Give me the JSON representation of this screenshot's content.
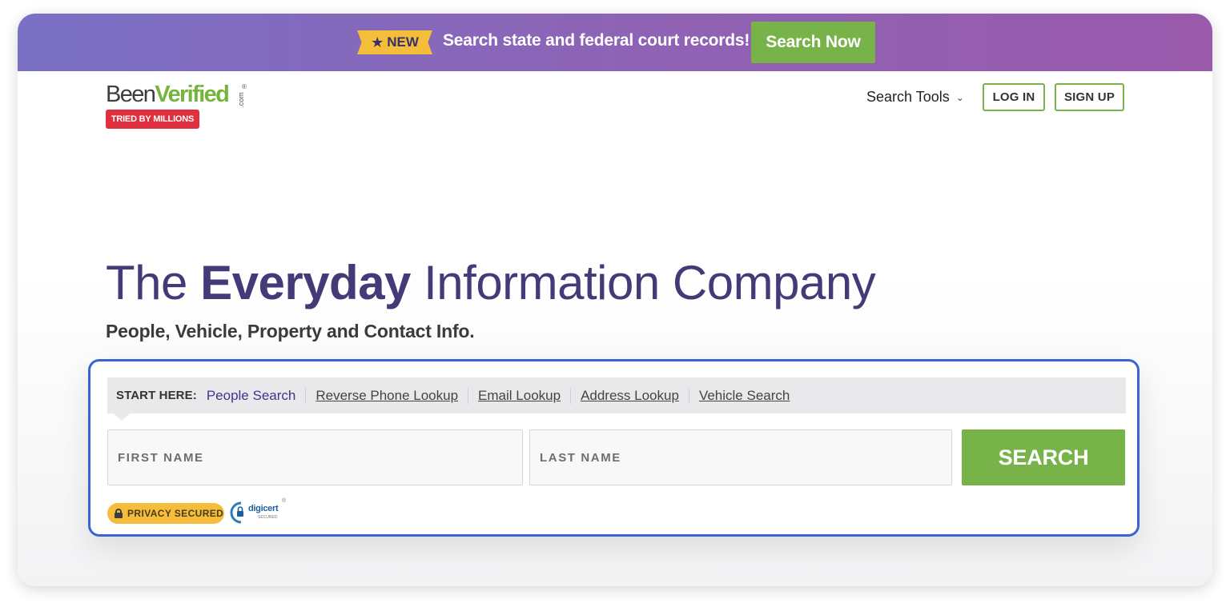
{
  "promo": {
    "badge": "NEW",
    "text": "Search state and federal court records!",
    "button": "Search Now"
  },
  "header": {
    "logo_part1": "Been",
    "logo_part2": "Verified",
    "logo_com": ".com",
    "logo_reg": "®",
    "tagline_badge": "TRIED BY MILLIONS",
    "nav_search_tools": "Search Tools",
    "login": "LOG IN",
    "signup": "SIGN UP"
  },
  "hero": {
    "headline_pre": "The ",
    "headline_bold": "Everyday",
    "headline_post": " Information Company",
    "subheadline": "People, Vehicle, Property and Contact Info."
  },
  "search": {
    "start_label": "START HERE:",
    "tabs": [
      {
        "label": "People Search",
        "active": true
      },
      {
        "label": "Reverse Phone Lookup",
        "active": false
      },
      {
        "label": "Email Lookup",
        "active": false
      },
      {
        "label": "Address Lookup",
        "active": false
      },
      {
        "label": "Vehicle Search",
        "active": false
      }
    ],
    "first_name_placeholder": "FIRST NAME",
    "last_name_placeholder": "LAST NAME",
    "button": "SEARCH",
    "privacy_badge": "PRIVACY SECURED",
    "digicert_label": "digicert",
    "digicert_sub": "SECURED",
    "digicert_reg": "®"
  },
  "colors": {
    "brand_green": "#78b34a",
    "brand_purple": "#443a78",
    "badge_red": "#e0303f",
    "badge_yellow": "#f5bd3b",
    "focus_blue": "#3c63d6"
  }
}
